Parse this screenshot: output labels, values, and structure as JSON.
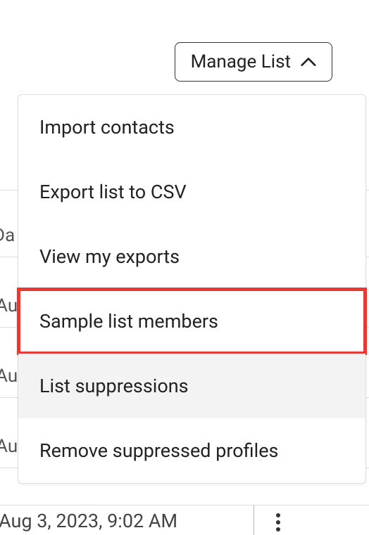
{
  "manage_list_button": {
    "label": "Manage List"
  },
  "dropdown": {
    "items": [
      {
        "label": "Import contacts",
        "highlighted": false,
        "hovered": false
      },
      {
        "label": "Export list to CSV",
        "highlighted": false,
        "hovered": false
      },
      {
        "label": "View my exports",
        "highlighted": false,
        "hovered": false
      },
      {
        "label": "Sample list members",
        "highlighted": true,
        "hovered": false
      },
      {
        "label": "List suppressions",
        "highlighted": false,
        "hovered": true
      },
      {
        "label": "Remove suppressed profiles",
        "highlighted": false,
        "hovered": false
      }
    ]
  },
  "background": {
    "date_header_fragment": "Da",
    "row_fragment_1": "Au",
    "row_fragment_2": "Au",
    "row_fragment_3": "Au",
    "last_row_text": "Aug 3, 2023, 9:02 AM"
  }
}
